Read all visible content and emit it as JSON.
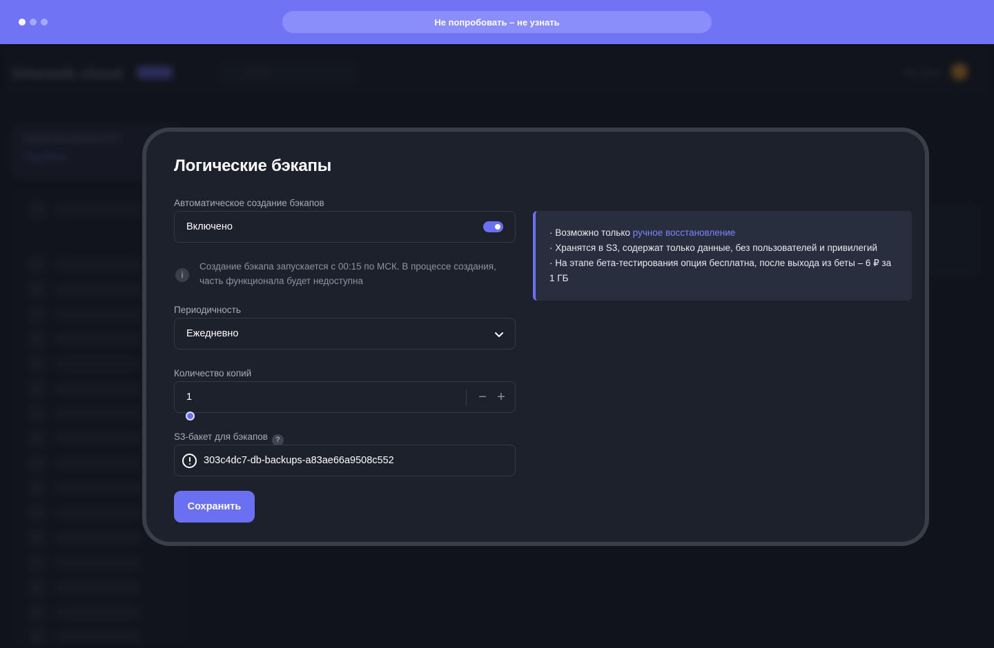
{
  "browser": {
    "url_text": "Не попробовать – не узнать"
  },
  "background": {
    "logo": "timeweb cloud",
    "search_placeholder": "Поиск",
    "account": "dev_team",
    "promo": "Бэкапы баз данных в S3",
    "promo_link": "Подробнее"
  },
  "modal": {
    "title": "Логические бэкапы",
    "auto_backup": {
      "label": "Автоматическое создание бэкапов",
      "value": "Включено",
      "enabled": true
    },
    "info": "Создание бэкапа запускается с 00:15 по МСК. В процессе создания, часть функционала будет недоступна",
    "periodicity": {
      "label": "Периодичность",
      "value": "Ежедневно"
    },
    "copies": {
      "label": "Количество копий",
      "value": "1",
      "minus": "−",
      "plus": "+"
    },
    "bucket": {
      "label": "S3-бакет для бэкапов",
      "help": "?",
      "value": "303c4dc7-db-backups-a83ae66a9508c552"
    },
    "save_label": "Сохранить",
    "note": {
      "line1_prefix": "· Возможно только ",
      "line1_link": "ручное восстановление",
      "line2": "· Хранятся в S3, содержат только данные, без пользователей и привилегий",
      "line3": "· На этапе бета-тестирования опция бесплатна, после выхода из беты – 6 ₽ за 1 ГБ"
    }
  },
  "colors": {
    "accent": "#6b6ff2",
    "topbar": "#7074f4",
    "modal_bg": "#1d212b",
    "link": "#7f84ff"
  }
}
